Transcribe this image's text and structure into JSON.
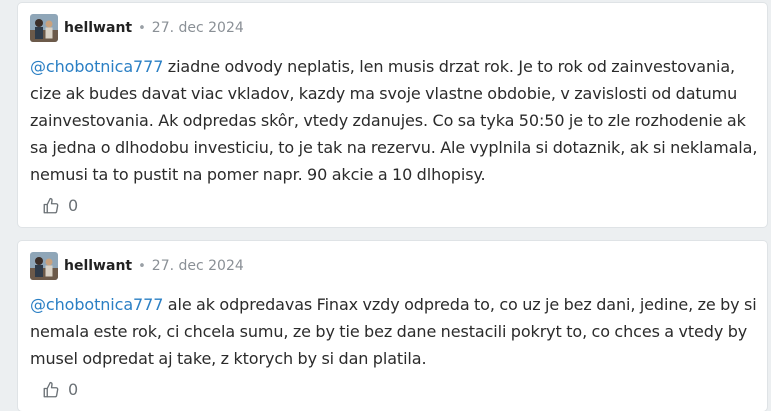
{
  "comments": [
    {
      "author": "hellwant",
      "separator": "•",
      "date": "27. dec 2024",
      "mention": "@chobotnica777",
      "text": " ziadne odvody neplatis, len musis drzat rok. Je to rok od zainvestovania, cize ak budes davat viac vkladov, kazdy ma svoje vlastne obdobie, v zavislosti od datumu zainvestovania. Ak odpredas skôr, vtedy zdanujes. Co sa tyka 50:50 je to zle rozhodenie ak sa jedna o dlhodobu investiciu, to je tak na rezervu. Ale vyplnila si dotaznik, ak si neklamala, nemusi ta to pustit na pomer napr. 90 akcie a 10 dlhopisy.",
      "likes": "0"
    },
    {
      "author": "hellwant",
      "separator": "•",
      "date": "27. dec 2024",
      "mention": "@chobotnica777",
      "text": " ale ak odpredavas Finax vzdy odpreda to, co uz je bez dani, jedine, ze by si nemala este rok, ci chcela sumu, ze by tie bez dane nestacili pokryt to, co chces a vtedy by musel odpredat aj take, z ktorych by si dan platila.",
      "likes": "0"
    }
  ],
  "colors": {
    "mention": "#2a7fc4",
    "background": "#eceff1",
    "card": "#ffffff"
  },
  "icons": {
    "like": "thumbs-up-icon",
    "avatar": "user-avatar-photo"
  }
}
